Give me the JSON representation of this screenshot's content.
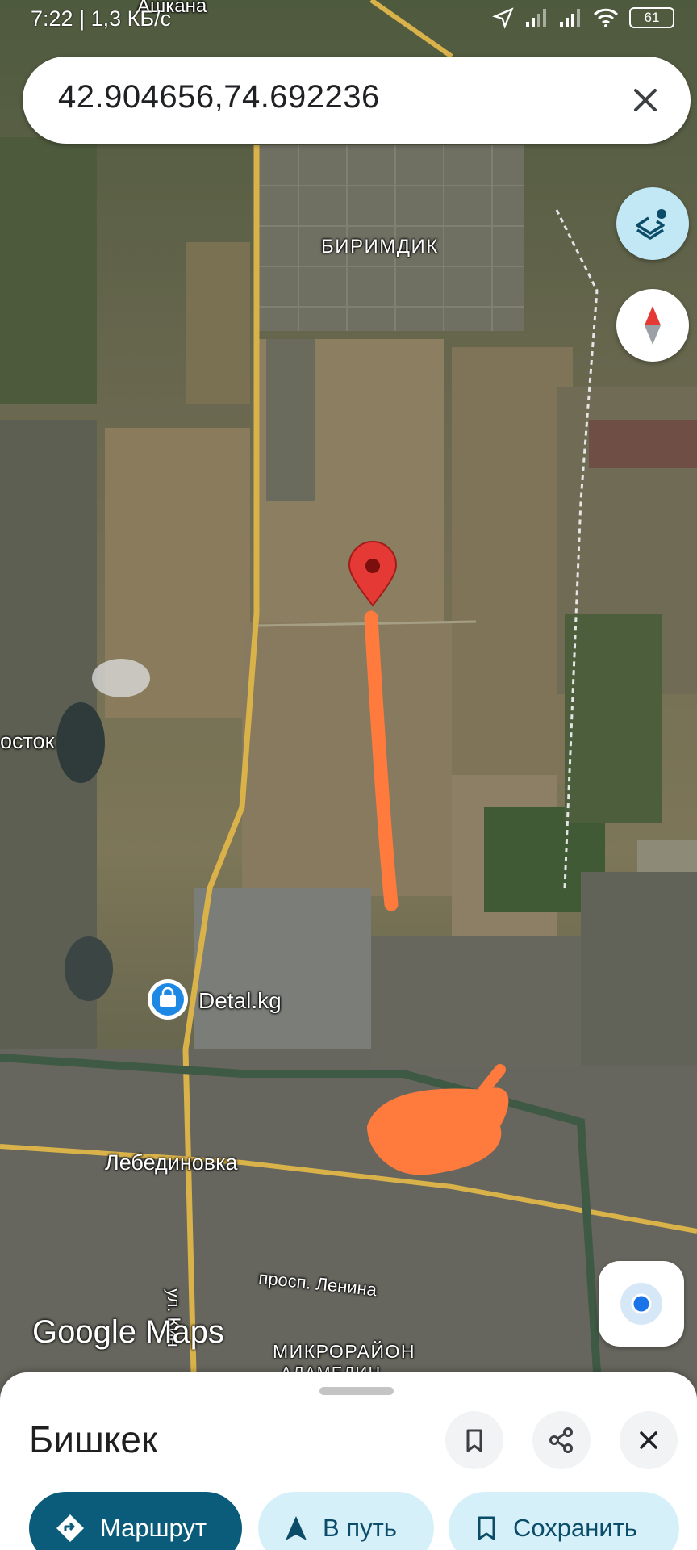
{
  "status_bar": {
    "time": "7:22",
    "speed": "1,3 КБ/с",
    "battery": "61"
  },
  "search": {
    "value": "42.904656,74.692236"
  },
  "map": {
    "labels": {
      "birimdik": "БИРИМДИК",
      "vostok": "осток",
      "ashkana": "Ашкана",
      "poi_detal": "Detal.kg",
      "lebedinovka": "Лебединовка",
      "lenin_ave": "просп. Ленина",
      "kin_street": "ул. Кин",
      "mikroraion": "МИКРОРАЙОН",
      "mikroraion_sub": "АЛАМЕДИН"
    },
    "logo": "Google Maps"
  },
  "sheet": {
    "title": "Бишкек",
    "chips": {
      "directions": "Маршрут",
      "start": "В путь",
      "save": "Сохранить"
    }
  },
  "colors": {
    "accent": "#0b5c7a",
    "chip_bg": "#d6f0fa",
    "pin": "#e53935",
    "drawn_line": "#ff7a3d"
  }
}
